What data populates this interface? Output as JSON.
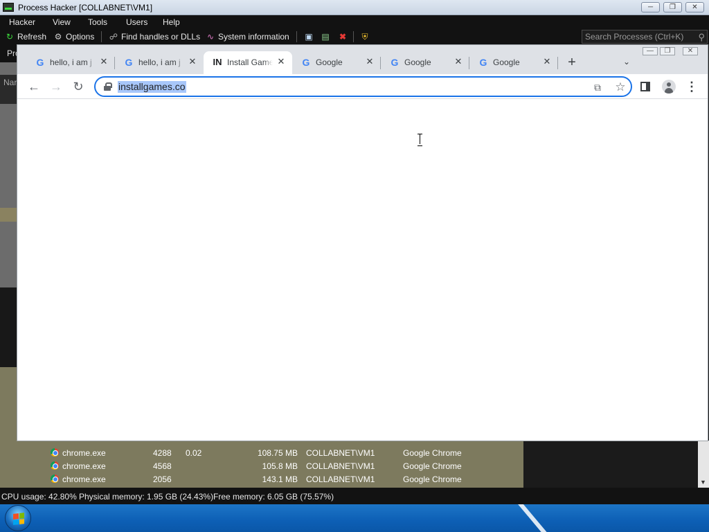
{
  "process_hacker": {
    "title": "Process Hacker [COLLABNET\\VM1]",
    "menu": [
      "Hacker",
      "View",
      "Tools",
      "Users",
      "Help"
    ],
    "toolbar": {
      "refresh": "Refresh",
      "options": "Options",
      "find_handles": "Find handles or DLLs",
      "system_information": "System information"
    },
    "search_placeholder": "Search Processes (Ctrl+K)",
    "left_tab_partial": "Pro",
    "left_column_partial": "Nar",
    "rows": [
      {
        "name": "chrome.exe",
        "pid": "4288",
        "cpu": "0.02",
        "private_bytes": "108.75 MB",
        "user": "COLLABNET\\VM1",
        "description": "Google Chrome"
      },
      {
        "name": "chrome.exe",
        "pid": "4568",
        "cpu": "",
        "private_bytes": "105.8 MB",
        "user": "COLLABNET\\VM1",
        "description": "Google Chrome"
      },
      {
        "name": "chrome.exe",
        "pid": "2056",
        "cpu": "",
        "private_bytes": "143.1 MB",
        "user": "COLLABNET\\VM1",
        "description": "Google Chrome"
      }
    ],
    "status": {
      "cpu_usage": "CPU usage: 42.80%",
      "physical_memory": "Physical memory: 1.95 GB (24.43%)",
      "free_memory": "Free memory: 6.05 GB (75.57%)"
    }
  },
  "chrome": {
    "tabs": [
      {
        "title": "hello, i am j",
        "favicon": "google-icon",
        "active": false
      },
      {
        "title": "hello, i am j",
        "favicon": "google-icon",
        "active": false
      },
      {
        "title": "Install Game",
        "favicon": "IN",
        "active": true
      },
      {
        "title": "Google",
        "favicon": "google-icon",
        "active": false
      },
      {
        "title": "Google",
        "favicon": "google-icon",
        "active": false
      },
      {
        "title": "Google",
        "favicon": "google-icon",
        "active": false
      }
    ],
    "address_bar": {
      "url": "installgames.co",
      "selected": true
    }
  },
  "colors": {
    "ph_dark": "#121212",
    "ph_rows_bg": "#7d7a5e",
    "chrome_tabstrip": "#dee1e6",
    "omnibox_focus": "#1a73e8",
    "selection": "#a8c7fa"
  }
}
